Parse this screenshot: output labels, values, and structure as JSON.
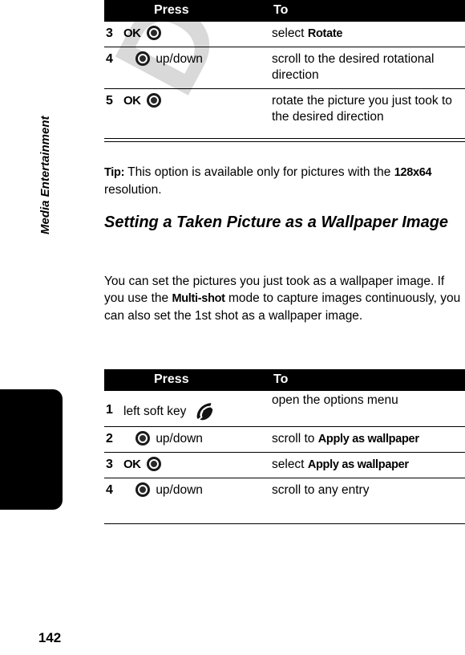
{
  "document": {
    "page_number": "142",
    "watermark": "DRAFT",
    "sidebar_label": "Media Entertainment",
    "accent_color": "#000000",
    "watermark_color": "#d9d9d9"
  },
  "table_one": {
    "headers": {
      "num": "",
      "press": "Press",
      "to": "To"
    },
    "rows": [
      {
        "num": "3",
        "press_label": "OK",
        "press_icon": "nav-wheel-icon",
        "press_suffix": "",
        "to_text": "select ",
        "to_bold": "Rotate",
        "to_tail": ""
      },
      {
        "num": "4",
        "press_label": "",
        "press_icon": "nav-wheel-icon",
        "press_suffix": "up/down",
        "to_text": "scroll to the desired rotational direction",
        "to_bold": "",
        "to_tail": ""
      },
      {
        "num": "5",
        "press_label": "OK",
        "press_icon": "nav-wheel-icon",
        "press_suffix": "",
        "to_text": "rotate the picture you just took to the desired direction",
        "to_bold": "",
        "to_tail": ""
      }
    ]
  },
  "tip": {
    "label": "Tip:",
    "text_before": " This option is available only for pictures with the ",
    "bold": "128x64",
    "text_after": " resolution."
  },
  "section": {
    "heading": "Setting a Taken Picture as a Wallpaper Image",
    "paragraph_before": "You can set the pictures you just took as a wallpaper image. If you use the ",
    "paragraph_bold": "Multi-shot",
    "paragraph_after": " mode to capture images continuously, you can also set the 1st shot as a wallpaper image."
  },
  "table_two": {
    "headers": {
      "num": "",
      "press": "Press",
      "to": "To"
    },
    "rows": [
      {
        "num": "1",
        "press_label": "left soft key",
        "press_icon": "soft-key-icon",
        "press_suffix": "",
        "to_text": "open the options menu",
        "to_bold": "",
        "to_tail": ""
      },
      {
        "num": "2",
        "press_label": "",
        "press_icon": "nav-wheel-icon",
        "press_suffix": "up/down",
        "to_text": "scroll to ",
        "to_bold": "Apply as wallpaper",
        "to_tail": ""
      },
      {
        "num": "3",
        "press_label": "OK",
        "press_icon": "nav-wheel-icon",
        "press_suffix": "",
        "to_text": "select ",
        "to_bold": "Apply as wallpaper",
        "to_tail": ""
      },
      {
        "num": "4",
        "press_label": "",
        "press_icon": "nav-wheel-icon",
        "press_suffix": "up/down",
        "to_text": "scroll to any entry",
        "to_bold": "",
        "to_tail": ""
      }
    ]
  }
}
